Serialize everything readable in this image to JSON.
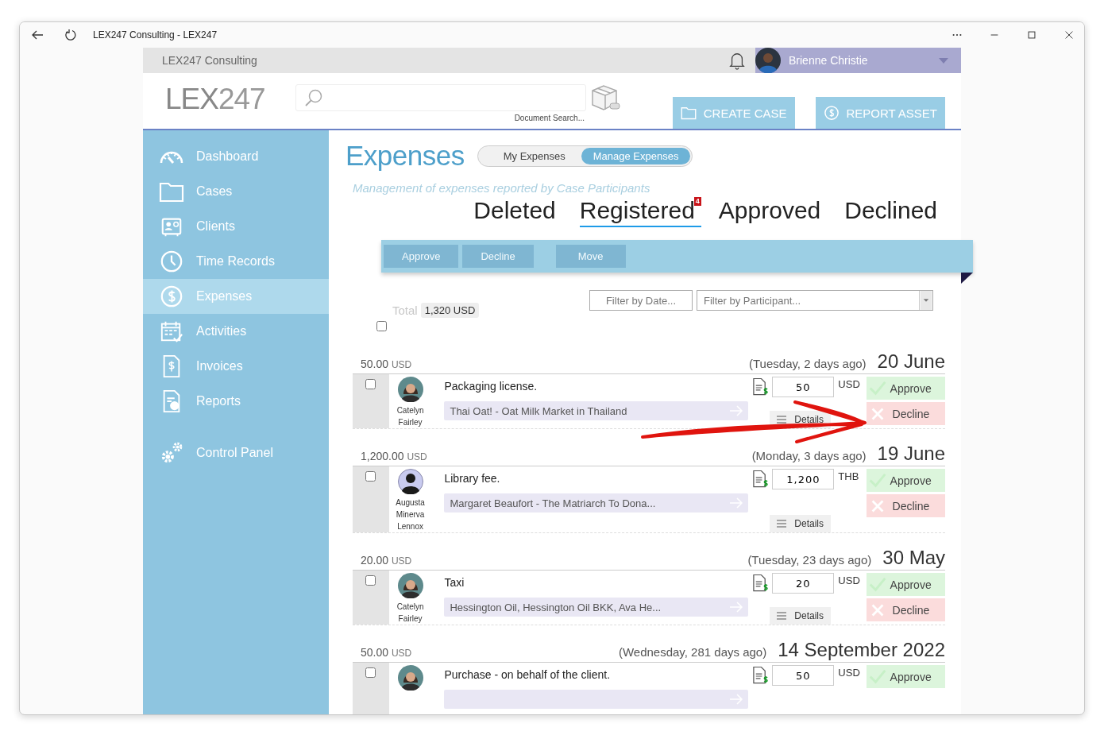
{
  "window": {
    "title": "LEX247 Consulting - LEX247"
  },
  "app_header": {
    "organization": "LEX247 Consulting",
    "user_name": "Brienne Christie"
  },
  "logo": "**LEX**247",
  "search": {
    "caption": "Document Search..."
  },
  "header_buttons": [
    {
      "label": "CREATE CASE",
      "kind": "folder"
    },
    {
      "label": "REPORT ASSET",
      "kind": "dollar"
    }
  ],
  "sidebar": {
    "items": [
      {
        "label": "Dashboard",
        "kind": "gauge",
        "selected": false
      },
      {
        "label": "Cases",
        "kind": "folder",
        "selected": false
      },
      {
        "label": "Clients",
        "kind": "contact",
        "selected": false
      },
      {
        "label": "Time Records",
        "kind": "clock",
        "selected": false
      },
      {
        "label": "Expenses",
        "kind": "dollar",
        "selected": true
      },
      {
        "label": "Activities",
        "kind": "calendar",
        "selected": false
      },
      {
        "label": "Invoices",
        "kind": "invoice",
        "selected": false
      },
      {
        "label": "Reports",
        "kind": "report",
        "selected": false
      },
      {
        "label": "Control Panel",
        "kind": "gears",
        "selected": false
      }
    ]
  },
  "page": {
    "title": "Expenses",
    "subtitle": "Management of expenses reported by Case Participants",
    "toggle": [
      {
        "label": "My Expenses",
        "selected": false
      },
      {
        "label": "Manage Expenses",
        "selected": true
      }
    ],
    "tabs": [
      {
        "label": "Deleted",
        "selected": false
      },
      {
        "label": "Registered",
        "selected": true,
        "badge": "4"
      },
      {
        "label": "Approved",
        "selected": false
      },
      {
        "label": "Declined",
        "selected": false
      }
    ],
    "actions": [
      {
        "label": "Approve",
        "disabled": true
      },
      {
        "label": "Decline",
        "disabled": true
      },
      {
        "label": "Move",
        "disabled": true
      }
    ],
    "filters": {
      "date_placeholder": "Filter by Date...",
      "participant_placeholder": "Filter by Participant..."
    },
    "total": {
      "label": "Total",
      "value": "1,320 USD"
    },
    "select_all": {
      "checked": false
    }
  },
  "expenses": [
    {
      "amount": "50.00",
      "amount_currency": "USD",
      "when": "(Tuesday, 2 days ago)",
      "date": "20 June",
      "checked": false,
      "person": "Catelyn Fairley",
      "kind": "photo",
      "description": "Packaging license.",
      "case": "Thai Oat! - Oat Milk Market in Thailand",
      "value": "50",
      "currency": "USD",
      "approve": "Approve",
      "decline": "Decline",
      "details": "Details"
    },
    {
      "amount": "1,200.00",
      "amount_currency": "USD",
      "when": "(Monday, 3 days ago)",
      "date": "19 June",
      "checked": false,
      "person": "Augusta Minerva Lennox",
      "kind": "silhouette",
      "description": "Library fee.",
      "case": "Margaret Beaufort - The Matriarch To Dona...",
      "value": "1,200",
      "currency": "THB",
      "approve": "Approve",
      "decline": "Decline",
      "details": "Details"
    },
    {
      "amount": "20.00",
      "amount_currency": "USD",
      "when": "(Tuesday, 23 days ago)",
      "date": "30 May",
      "checked": false,
      "person": "Catelyn Fairley",
      "kind": "photo",
      "description": "Taxi",
      "case": "Hessington Oil, Hessington Oil BKK, Ava He...",
      "value": "20",
      "currency": "USD",
      "approve": "Approve",
      "decline": "Decline",
      "details": "Details"
    },
    {
      "amount": "50.00",
      "amount_currency": "USD",
      "when": "(Wednesday, 281 days ago)",
      "date": "14 September 2022",
      "checked": false,
      "kind": "photo",
      "description": "Purchase - on behalf of the client.",
      "value": "50",
      "currency": "USD",
      "approve": "Approve"
    }
  ]
}
